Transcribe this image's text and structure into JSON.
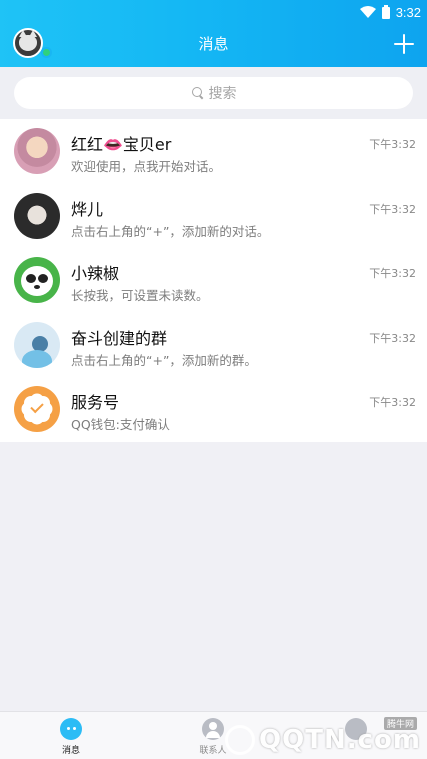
{
  "status_bar": {
    "time": "3:32"
  },
  "header": {
    "title": "消息"
  },
  "search": {
    "placeholder": "搜索"
  },
  "conversations": [
    {
      "name": "红红👄宝贝er",
      "message": "欢迎使用，点我开始对话。",
      "time": "下午3:32"
    },
    {
      "name": "烨儿",
      "message": "点击右上角的“+”，添加新的对话。",
      "time": "下午3:32"
    },
    {
      "name": "小辣椒",
      "message": "长按我，可设置未读数。",
      "time": "下午3:32"
    },
    {
      "name": "奋斗创建的群",
      "message": "点击右上角的“+”，添加新的群。",
      "time": "下午3:32"
    },
    {
      "name": "服务号",
      "message": "QQ钱包:支付确认",
      "time": "下午3:32"
    }
  ],
  "tabs": [
    {
      "label": "消息",
      "icon": "chat-bubble-icon",
      "active": true
    },
    {
      "label": "联系人",
      "icon": "contacts-icon",
      "active": false
    },
    {
      "label": "",
      "icon": "star-icon",
      "active": false
    }
  ],
  "watermark": {
    "text": "QQTN.com",
    "small": "腾牛网"
  },
  "colors": {
    "header_start": "#1fc3f6",
    "header_end": "#0ea4ef",
    "accent": "#2cbcf5",
    "online": "#2fd17d"
  }
}
